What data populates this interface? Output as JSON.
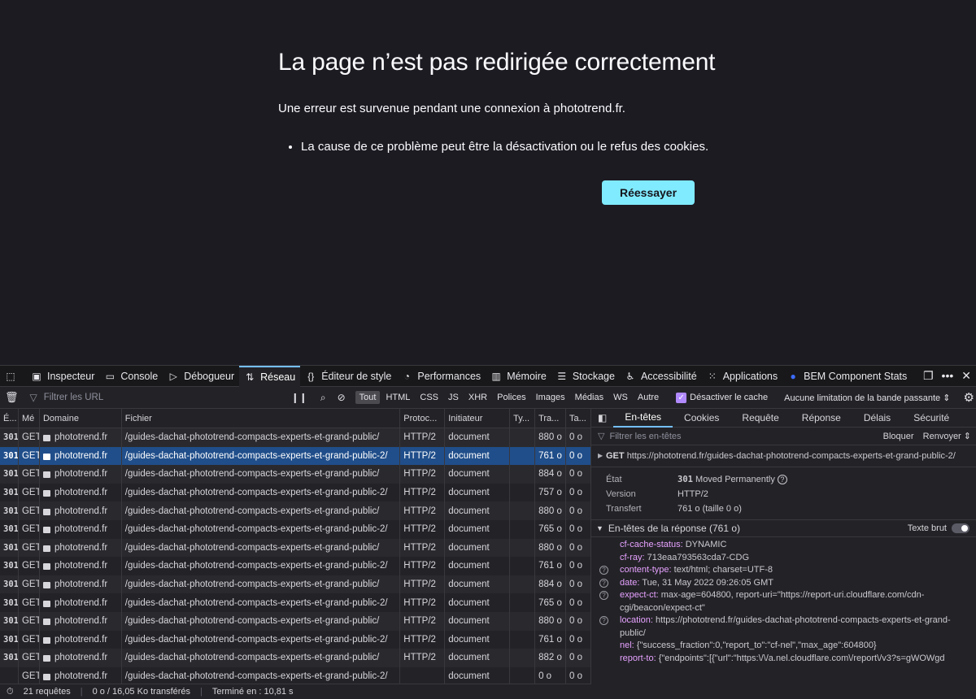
{
  "error_page": {
    "title": "La page n’est pas redirigée correctement",
    "description": "Une erreur est survenue pendant une connexion à phototrend.fr.",
    "bullet": "La cause de ce problème peut être la désactivation ou le refus des cookies.",
    "retry_label": "Réessayer"
  },
  "devtools": {
    "tabs": [
      {
        "label": "Inspecteur",
        "icon": "inspector-icon"
      },
      {
        "label": "Console",
        "icon": "console-icon"
      },
      {
        "label": "Débogueur",
        "icon": "debugger-icon"
      },
      {
        "label": "Réseau",
        "icon": "network-icon"
      },
      {
        "label": "Éditeur de style",
        "icon": "style-editor-icon"
      },
      {
        "label": "Performances",
        "icon": "performance-icon"
      },
      {
        "label": "Mémoire",
        "icon": "memory-icon"
      },
      {
        "label": "Stockage",
        "icon": "storage-icon"
      },
      {
        "label": "Accessibilité",
        "icon": "accessibility-icon"
      },
      {
        "label": "Applications",
        "icon": "applications-icon"
      },
      {
        "label": "BEM Component Stats",
        "icon": "bem-extension-icon"
      }
    ],
    "toolbar": {
      "filter_placeholder": "Filtrer les URL",
      "types": [
        "Tout",
        "HTML",
        "CSS",
        "JS",
        "XHR",
        "Polices",
        "Images",
        "Médias",
        "WS",
        "Autre"
      ],
      "disable_cache": "Désactiver le cache",
      "throttle": "Aucune limitation de la bande passante ⇕"
    },
    "columns": [
      "É...",
      "Mé",
      "Domaine",
      "Fichier",
      "Protoc...",
      "Initiateur",
      "Ty...",
      "Tra...",
      "Ta..."
    ],
    "rows": [
      {
        "status": "301",
        "method": "GET",
        "domain": "phototrend.fr",
        "file": "/guides-dachat-phototrend-compacts-experts-et-grand-public/",
        "protocol": "HTTP/2",
        "initiator": "document",
        "type": "",
        "transferred": "880 o",
        "size": "0 o"
      },
      {
        "status": "301",
        "method": "GET",
        "domain": "phototrend.fr",
        "file": "/guides-dachat-phototrend-compacts-experts-et-grand-public-2/",
        "protocol": "HTTP/2",
        "initiator": "document",
        "type": "",
        "transferred": "761 o",
        "size": "0 o"
      },
      {
        "status": "301",
        "method": "GET",
        "domain": "phototrend.fr",
        "file": "/guides-dachat-phototrend-compacts-experts-et-grand-public/",
        "protocol": "HTTP/2",
        "initiator": "document",
        "type": "",
        "transferred": "884 o",
        "size": "0 o"
      },
      {
        "status": "301",
        "method": "GET",
        "domain": "phototrend.fr",
        "file": "/guides-dachat-phototrend-compacts-experts-et-grand-public-2/",
        "protocol": "HTTP/2",
        "initiator": "document",
        "type": "",
        "transferred": "757 o",
        "size": "0 o"
      },
      {
        "status": "301",
        "method": "GET",
        "domain": "phototrend.fr",
        "file": "/guides-dachat-phototrend-compacts-experts-et-grand-public/",
        "protocol": "HTTP/2",
        "initiator": "document",
        "type": "",
        "transferred": "880 o",
        "size": "0 o"
      },
      {
        "status": "301",
        "method": "GET",
        "domain": "phototrend.fr",
        "file": "/guides-dachat-phototrend-compacts-experts-et-grand-public-2/",
        "protocol": "HTTP/2",
        "initiator": "document",
        "type": "",
        "transferred": "765 o",
        "size": "0 o"
      },
      {
        "status": "301",
        "method": "GET",
        "domain": "phototrend.fr",
        "file": "/guides-dachat-phototrend-compacts-experts-et-grand-public/",
        "protocol": "HTTP/2",
        "initiator": "document",
        "type": "",
        "transferred": "880 o",
        "size": "0 o"
      },
      {
        "status": "301",
        "method": "GET",
        "domain": "phototrend.fr",
        "file": "/guides-dachat-phototrend-compacts-experts-et-grand-public-2/",
        "protocol": "HTTP/2",
        "initiator": "document",
        "type": "",
        "transferred": "761 o",
        "size": "0 o"
      },
      {
        "status": "301",
        "method": "GET",
        "domain": "phototrend.fr",
        "file": "/guides-dachat-phototrend-compacts-experts-et-grand-public/",
        "protocol": "HTTP/2",
        "initiator": "document",
        "type": "",
        "transferred": "884 o",
        "size": "0 o"
      },
      {
        "status": "301",
        "method": "GET",
        "domain": "phototrend.fr",
        "file": "/guides-dachat-phototrend-compacts-experts-et-grand-public-2/",
        "protocol": "HTTP/2",
        "initiator": "document",
        "type": "",
        "transferred": "765 o",
        "size": "0 o"
      },
      {
        "status": "301",
        "method": "GET",
        "domain": "phototrend.fr",
        "file": "/guides-dachat-phototrend-compacts-experts-et-grand-public/",
        "protocol": "HTTP/2",
        "initiator": "document",
        "type": "",
        "transferred": "880 o",
        "size": "0 o"
      },
      {
        "status": "301",
        "method": "GET",
        "domain": "phototrend.fr",
        "file": "/guides-dachat-phototrend-compacts-experts-et-grand-public-2/",
        "protocol": "HTTP/2",
        "initiator": "document",
        "type": "",
        "transferred": "761 o",
        "size": "0 o"
      },
      {
        "status": "301",
        "method": "GET",
        "domain": "phototrend.fr",
        "file": "/guides-dachat-phototrend-compacts-experts-et-grand-public/",
        "protocol": "HTTP/2",
        "initiator": "document",
        "type": "",
        "transferred": "882 o",
        "size": "0 o"
      },
      {
        "status": "",
        "method": "GET",
        "domain": "phototrend.fr",
        "file": "/guides-dachat-phototrend-compacts-experts-et-grand-public-2/",
        "protocol": "",
        "initiator": "document",
        "type": "",
        "transferred": "0 o",
        "size": "0 o"
      }
    ],
    "status_bar": {
      "requests": "21 requêtes",
      "transferred": "0 o / 16,05 Ko transférés",
      "finished": "Terminé en : 10,81 s"
    },
    "details": {
      "tabs": [
        "En-têtes",
        "Cookies",
        "Requête",
        "Réponse",
        "Délais",
        "Sécurité"
      ],
      "filter_placeholder": "Filtrer les en-têtes",
      "block": "Bloquer",
      "resend": "Renvoyer ⇕",
      "request_method": "GET",
      "request_url": "https://phototrend.fr/guides-dachat-phototrend-compacts-experts-et-grand-public-2/",
      "state_label": "État",
      "state_code": "301",
      "state_text": "Moved Permanently",
      "version_label": "Version",
      "version_value": "HTTP/2",
      "transfer_label": "Transfert",
      "transfer_value": "761 o (taille 0 o)",
      "response_headers_title": "En-têtes de la réponse (761 o)",
      "raw_label": "Texte brut",
      "headers": [
        {
          "name": "cf-cache-status:",
          "value": "DYNAMIC",
          "hint": false
        },
        {
          "name": "cf-ray:",
          "value": "713eaa793563cda7-CDG",
          "hint": false
        },
        {
          "name": "content-type:",
          "value": "text/html; charset=UTF-8",
          "hint": true
        },
        {
          "name": "date:",
          "value": "Tue, 31 May 2022 09:26:05 GMT",
          "hint": true
        },
        {
          "name": "expect-ct:",
          "value": "max-age=604800, report-uri=\"https://report-uri.cloudflare.com/cdn-cgi/beacon/expect-ct\"",
          "hint": true
        },
        {
          "name": "location:",
          "value": "https://phototrend.fr/guides-dachat-phototrend-compacts-experts-et-grand-public/",
          "hint": true
        },
        {
          "name": "nel:",
          "value": "{\"success_fraction\":0,\"report_to\":\"cf-nel\",\"max_age\":604800}",
          "hint": false
        },
        {
          "name": "report-to:",
          "value": "{\"endpoints\":[{\"url\":\"https:\\/\\/a.nel.cloudflare.com\\/report\\/v3?s=gWOWgd",
          "hint": false
        }
      ]
    }
  }
}
